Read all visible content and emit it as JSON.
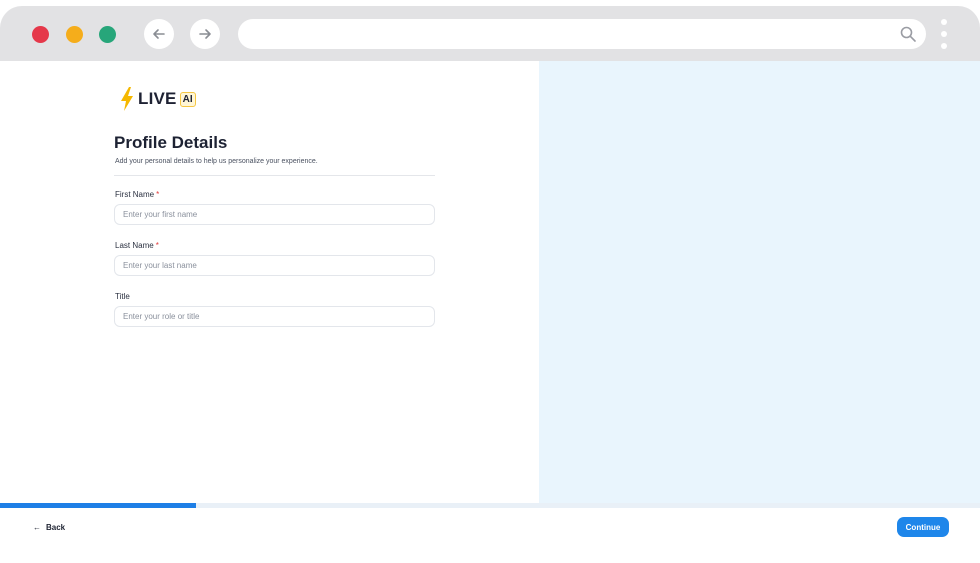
{
  "browser": {
    "url_value": "",
    "icons": [
      "back-arrow-icon",
      "forward-arrow-icon",
      "search-icon",
      "more-vertical-icon"
    ]
  },
  "brand": {
    "logo_word": "LIVE",
    "logo_badge": "AI",
    "bolt_color": "#f5b800"
  },
  "form": {
    "title": "Profile Details",
    "subtitle": "Add your personal details to help us personalize your experience.",
    "fields": [
      {
        "label": "First Name",
        "required_mark": "*",
        "placeholder": "Enter your first name",
        "value": ""
      },
      {
        "label": "Last Name",
        "required_mark": "*",
        "placeholder": "Enter your last name",
        "value": ""
      },
      {
        "label": "Title",
        "placeholder": "Enter your role or title",
        "value": ""
      }
    ]
  },
  "progress": {
    "fraction": 0.2
  },
  "footer": {
    "back_label": "Back",
    "continue_label": "Continue"
  },
  "colors": {
    "accent": "#1e86ea",
    "right_panel": "#e9f5fd",
    "required": "#e03b3b"
  }
}
